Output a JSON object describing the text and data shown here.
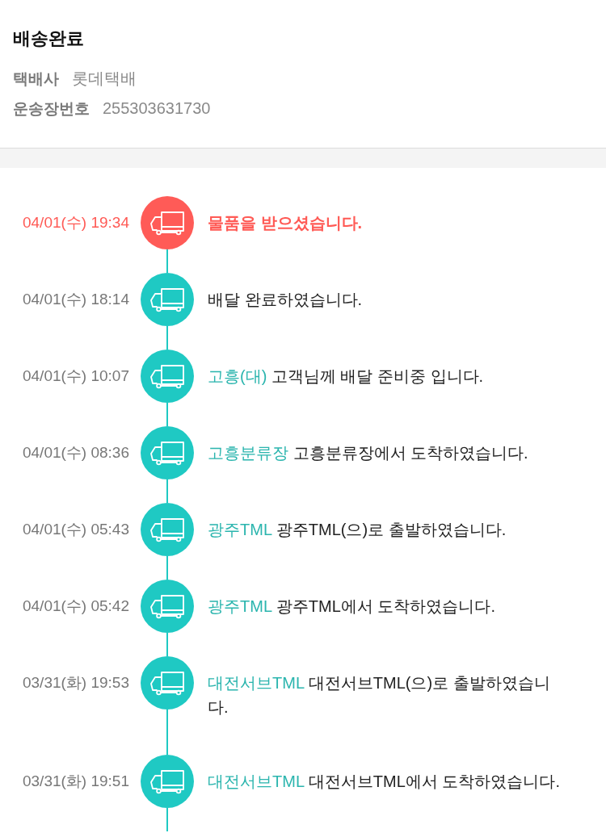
{
  "header": {
    "title": "배송완료",
    "details": [
      {
        "label": "택배사",
        "value": "롯데택배"
      },
      {
        "label": "운송장번호",
        "value": "255303631730"
      }
    ]
  },
  "timeline": [
    {
      "time": "04/01(수) 19:34",
      "message": "물품을 받으셨습니다.",
      "current": true
    },
    {
      "time": "04/01(수) 18:14",
      "message": "배달 완료하였습니다.",
      "current": false
    },
    {
      "time": "04/01(수) 10:07",
      "place": "고흥(대)",
      "message": "고객님께 배달 준비중 입니다.",
      "current": false
    },
    {
      "time": "04/01(수) 08:36",
      "place": "고흥분류장",
      "message": "고흥분류장에서 도착하였습니다.",
      "current": false
    },
    {
      "time": "04/01(수) 05:43",
      "place": "광주TML",
      "message": "광주TML(으)로 출발하였습니다.",
      "current": false
    },
    {
      "time": "04/01(수) 05:42",
      "place": "광주TML",
      "message": "광주TML에서 도착하였습니다.",
      "current": false
    },
    {
      "time": "03/31(화) 19:53",
      "place": "대전서브TML",
      "message": "대전서브TML(으)로 출발하였습니다.",
      "current": false
    },
    {
      "time": "03/31(화) 19:51",
      "place": "대전서브TML",
      "message": "대전서브TML에서 도착하였습니다.",
      "current": false
    }
  ]
}
